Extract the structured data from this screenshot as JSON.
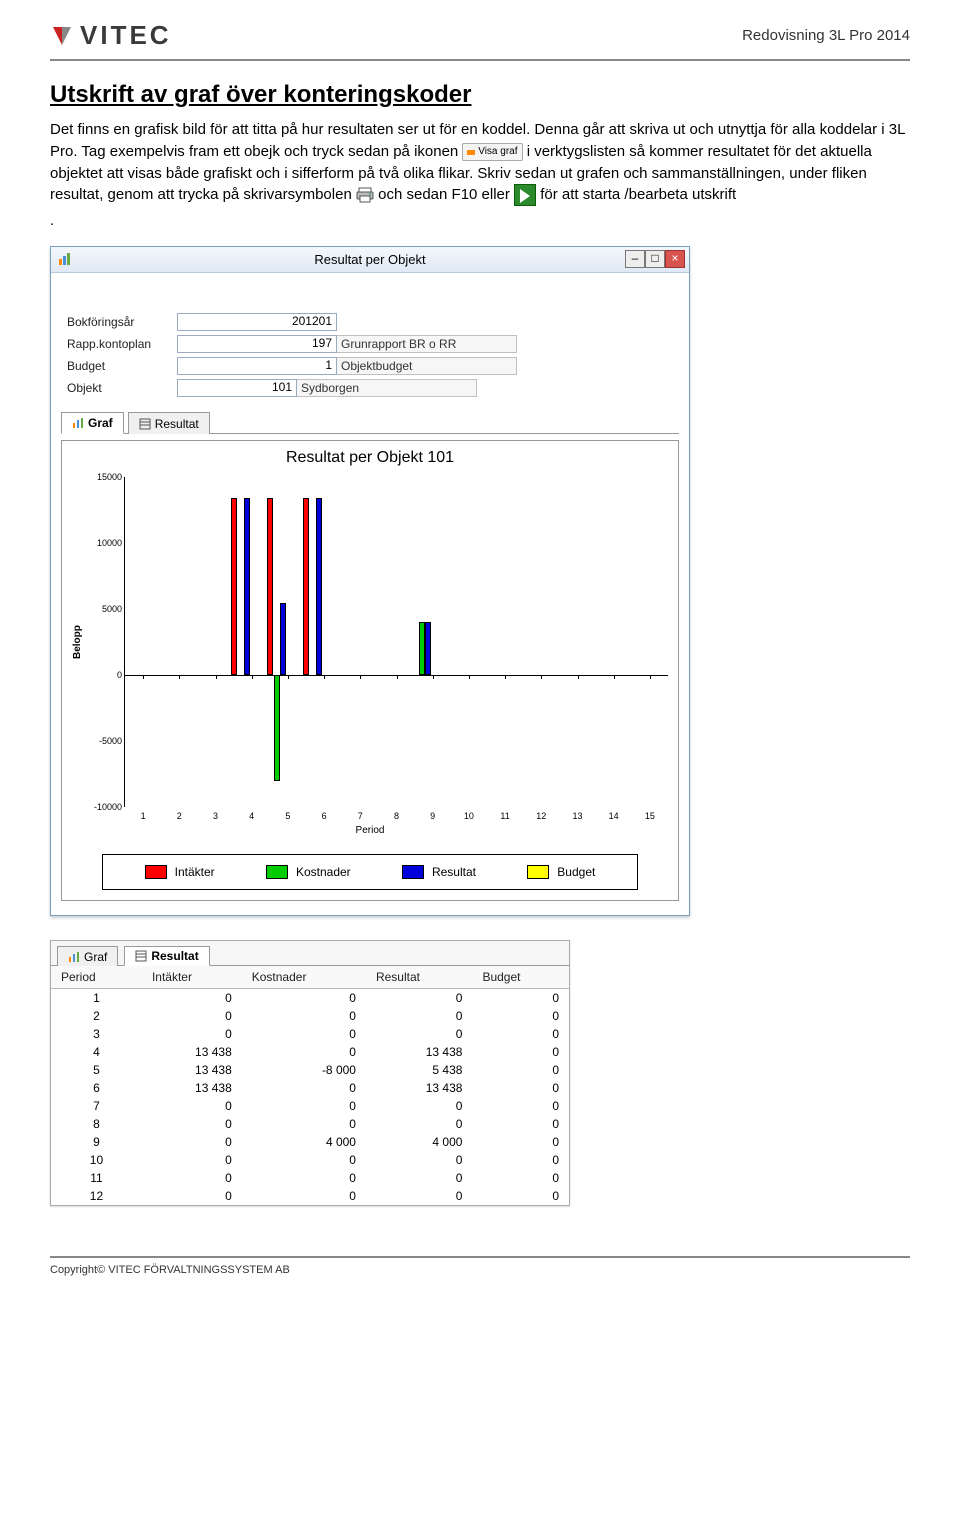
{
  "header": {
    "brand": "VITEC",
    "doc_title": "Redovisning 3L Pro 2014"
  },
  "section": {
    "title": "Utskrift av graf över konteringskoder",
    "para1": "Det finns en grafisk bild för att titta på hur resultaten ser ut för en koddel. Denna går att skriva ut och utnyttja för alla koddelar i 3L Pro. Tag exempelvis fram ett obejk och tryck sedan på ikonen ",
    "icon_visa_graf_label": "Visa graf",
    "para1b": " i verktygslisten så kommer resultatet för det aktuella objektet att visas både grafiskt och i sifferform på två olika flikar. Skriv sedan ut grafen och sammanställningen, under fliken resultat, genom att trycka på skrivarsymbolen ",
    "para1c": " och sedan F10 eller ",
    "para1d": " för att starta /bearbeta utskrift",
    "para1e": "."
  },
  "window": {
    "title": "Resultat per Objekt",
    "minimize": "–",
    "maximize": "□",
    "close": "×",
    "form": {
      "rows": [
        {
          "label": "Bokföringsår",
          "value": "201201",
          "valueWidth": 160,
          "desc": ""
        },
        {
          "label": "Rapp.kontoplan",
          "value": "197",
          "valueWidth": 160,
          "desc": "Grunrapport BR o RR"
        },
        {
          "label": "Budget",
          "value": "1",
          "valueWidth": 160,
          "desc": "Objektbudget"
        },
        {
          "label": "Objekt",
          "value": "101",
          "valueWidth": 120,
          "desc": "Sydborgen"
        }
      ]
    },
    "tabs": {
      "graf": "Graf",
      "resultat": "Resultat"
    },
    "chart_title": "Resultat per Objekt 101"
  },
  "chart_data": {
    "type": "bar",
    "title": "Resultat per Objekt 101",
    "xlabel": "Period",
    "ylabel": "Belopp",
    "ylim": [
      -10000,
      15000
    ],
    "yticks": [
      -10000,
      -5000,
      0,
      5000,
      10000,
      15000
    ],
    "categories": [
      1,
      2,
      3,
      4,
      5,
      6,
      7,
      8,
      9,
      10,
      11,
      12,
      13,
      14,
      15
    ],
    "series": [
      {
        "name": "Intäkter",
        "color": "#ff0000",
        "values": [
          0,
          0,
          0,
          13438,
          13438,
          13438,
          0,
          0,
          0,
          0,
          0,
          0,
          0,
          0,
          0
        ]
      },
      {
        "name": "Kostnader",
        "color": "#00cc00",
        "values": [
          0,
          0,
          0,
          0,
          -8000,
          0,
          0,
          0,
          4000,
          0,
          0,
          0,
          0,
          0,
          0
        ]
      },
      {
        "name": "Resultat",
        "color": "#0000dd",
        "values": [
          0,
          0,
          0,
          13438,
          5438,
          13438,
          0,
          0,
          4000,
          0,
          0,
          0,
          0,
          0,
          0
        ]
      },
      {
        "name": "Budget",
        "color": "#ffff00",
        "values": [
          0,
          0,
          0,
          0,
          0,
          0,
          0,
          0,
          0,
          0,
          0,
          0,
          0,
          0,
          0
        ]
      }
    ]
  },
  "legend": [
    "Intäkter",
    "Kostnader",
    "Resultat",
    "Budget"
  ],
  "result_panel": {
    "tab_graf": "Graf",
    "tab_resultat": "Resultat",
    "headers": [
      "Period",
      "Intäkter",
      "Kostnader",
      "Resultat",
      "Budget"
    ],
    "rows": [
      [
        1,
        "0",
        "0",
        "0",
        "0"
      ],
      [
        2,
        "0",
        "0",
        "0",
        "0"
      ],
      [
        3,
        "0",
        "0",
        "0",
        "0"
      ],
      [
        4,
        "13 438",
        "0",
        "13 438",
        "0"
      ],
      [
        5,
        "13 438",
        "-8 000",
        "5 438",
        "0"
      ],
      [
        6,
        "13 438",
        "0",
        "13 438",
        "0"
      ],
      [
        7,
        "0",
        "0",
        "0",
        "0"
      ],
      [
        8,
        "0",
        "0",
        "0",
        "0"
      ],
      [
        9,
        "0",
        "4 000",
        "4 000",
        "0"
      ],
      [
        10,
        "0",
        "0",
        "0",
        "0"
      ],
      [
        11,
        "0",
        "0",
        "0",
        "0"
      ],
      [
        12,
        "0",
        "0",
        "0",
        "0"
      ]
    ]
  },
  "footer": {
    "text_prefix": "Copyright© V",
    "text_suffix": "ITEC FÖRVALTNINGSSYSTEM AB"
  }
}
